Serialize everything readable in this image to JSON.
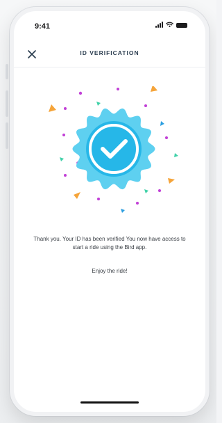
{
  "status_bar": {
    "time": "9:41",
    "icons": [
      "signal-icon",
      "wifi-icon",
      "battery-icon"
    ]
  },
  "nav": {
    "close_icon": "close-icon",
    "title": "ID VERIFICATION"
  },
  "badge": {
    "icon": "verified-badge-icon",
    "check_icon": "checkmark-icon",
    "colors": {
      "badge_outer": "#5ed0f0",
      "badge_inner": "#26b7e8",
      "check": "#ffffff"
    }
  },
  "confetti": {
    "colors": [
      "#c13fd6",
      "#2d9fe0",
      "#f5a43a",
      "#3fd1a8"
    ]
  },
  "message": {
    "body": "Thank you. Your ID has been verified You now have access to start a ride using the Bird app.",
    "sub": "Enjoy the ride!"
  }
}
